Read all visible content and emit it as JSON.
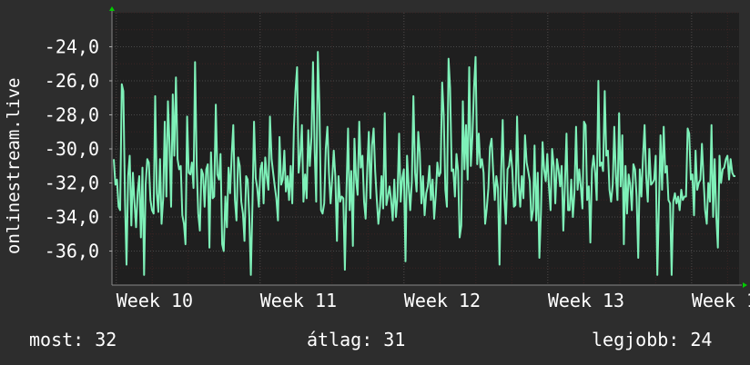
{
  "colors": {
    "background": "#2d2d2d",
    "plot_background": "#1f1f1f",
    "line": "#7ef0b8",
    "grid_major": "#4a4a4a",
    "grid_minor": "#3a2323",
    "text": "#ffffff",
    "axis_arrow": "#00cc00"
  },
  "chart_data": {
    "type": "line",
    "ylabel": "onlinestream.live",
    "ylim": [
      -38.0,
      -22.0
    ],
    "yticks": [
      "-24,0",
      "-26,0",
      "-28,0",
      "-30,0",
      "-32,0",
      "-34,0",
      "-36,0"
    ],
    "yticks_values": [
      -24,
      -26,
      -28,
      -30,
      -32,
      -34,
      -36
    ],
    "xticks": [
      "Week 10",
      "Week 11",
      "Week 12",
      "Week 13",
      "Week 1"
    ],
    "xticks_pos": [
      10,
      11,
      12,
      13,
      14
    ],
    "xlim": [
      9.97,
      14.33
    ],
    "grid": true,
    "series": [
      {
        "values": [
          -30.6,
          -32.1,
          -31.8,
          -33.4,
          -33.6,
          -26.2,
          -26.6,
          -32.9,
          -36.8,
          -31.6,
          -30.4,
          -34.5,
          -31.4,
          -33.2,
          -34.6,
          -32.5,
          -31.6,
          -35.2,
          -31.1,
          -37.4,
          -32.1,
          -30.6,
          -30.8,
          -33.0,
          -33.6,
          -33.8,
          -26.9,
          -32.6,
          -33.7,
          -30.6,
          -34.4,
          -32.9,
          -28.4,
          -32.8,
          -27.2,
          -29.8,
          -33.4,
          -26.8,
          -30.4,
          -25.8,
          -30.6,
          -31.2,
          -31.0,
          -33.9,
          -34.4,
          -35.6,
          -28.1,
          -31.4,
          -31.5,
          -30.8,
          -32.3,
          -24.9,
          -31.0,
          -33.8,
          -34.8,
          -31.2,
          -31.5,
          -33.4,
          -31.2,
          -30.9,
          -35.8,
          -30.2,
          -32.9,
          -32.8,
          -27.4,
          -31.5,
          -31.8,
          -30.3,
          -35.6,
          -36.0,
          -32.8,
          -34.6,
          -31.1,
          -32.6,
          -30.3,
          -28.6,
          -33.0,
          -34.2,
          -30.5,
          -31.0,
          -33.1,
          -33.8,
          -35.4,
          -31.6,
          -31.8,
          -34.0,
          -37.4,
          -33.2,
          -28.4,
          -31.7,
          -32.3,
          -33.4,
          -31.2,
          -30.8,
          -33.2,
          -30.5,
          -31.6,
          -32.4,
          -28.1,
          -30.6,
          -31.4,
          -32.2,
          -32.9,
          -34.2,
          -29.3,
          -32.1,
          -31.8,
          -30.1,
          -32.5,
          -31.6,
          -33.0,
          -31.0,
          -33.2,
          -28.8,
          -26.6,
          -25.2,
          -31.4,
          -30.4,
          -28.6,
          -33.1,
          -31.5,
          -32.9,
          -28.9,
          -31.0,
          -29.3,
          -24.9,
          -30.1,
          -33.1,
          -24.3,
          -27.4,
          -33.6,
          -33.8,
          -33.2,
          -30.0,
          -28.7,
          -31.4,
          -33.2,
          -31.8,
          -30.1,
          -31.6,
          -35.4,
          -31.6,
          -33.1,
          -32.8,
          -32.9,
          -37.1,
          -32.4,
          -28.8,
          -33.6,
          -31.3,
          -35.7,
          -29.4,
          -31.8,
          -32.7,
          -28.4,
          -31.1,
          -30.4,
          -33.1,
          -34.1,
          -31.2,
          -29.0,
          -32.9,
          -29.8,
          -28.8,
          -31.3,
          -33.0,
          -34.4,
          -33.4,
          -31.6,
          -33.5,
          -27.9,
          -33.3,
          -32.8,
          -32.2,
          -33.0,
          -34.2,
          -31.8,
          -34.0,
          -32.8,
          -29.1,
          -33.1,
          -31.7,
          -31.2,
          -36.6,
          -30.4,
          -32.2,
          -33.6,
          -31.9,
          -26.9,
          -31.4,
          -32.5,
          -29.0,
          -30.2,
          -33.2,
          -31.6,
          -33.9,
          -32.6,
          -32.2,
          -31.0,
          -33.0,
          -31.8,
          -34.1,
          -32.7,
          -30.8,
          -31.6,
          -31.4,
          -26.1,
          -28.0,
          -32.4,
          -33.4,
          -24.7,
          -26.4,
          -31.3,
          -31.2,
          -32.8,
          -30.3,
          -31.3,
          -35.2,
          -34.5,
          -27.2,
          -31.2,
          -28.6,
          -31.8,
          -25.2,
          -31.0,
          -29.3,
          -26.4,
          -24.6,
          -30.9,
          -29.1,
          -31.1,
          -30.6,
          -31.4,
          -34.4,
          -33.5,
          -32.3,
          -29.9,
          -29.4,
          -31.3,
          -33.0,
          -31.6,
          -32.3,
          -36.8,
          -31.3,
          -28.3,
          -32.8,
          -34.4,
          -31.2,
          -31.0,
          -30.1,
          -31.2,
          -33.4,
          -33.3,
          -28.1,
          -32.0,
          -33.4,
          -31.6,
          -32.9,
          -29.2,
          -30.8,
          -31.3,
          -31.9,
          -34.2,
          -33.6,
          -29.8,
          -34.2,
          -31.4,
          -36.4,
          -33.8,
          -29.6,
          -31.2,
          -31.9,
          -30.3,
          -32.2,
          -33.6,
          -30.0,
          -31.0,
          -33.2,
          -30.6,
          -31.2,
          -32.2,
          -31.0,
          -34.8,
          -32.2,
          -29.1,
          -33.6,
          -33.6,
          -31.8,
          -34.0,
          -32.6,
          -28.7,
          -32.4,
          -31.2,
          -32.2,
          -33.5,
          -28.4,
          -28.6,
          -33.0,
          -32.2,
          -35.5,
          -31.2,
          -30.4,
          -31.4,
          -33.0,
          -26.0,
          -31.0,
          -30.8,
          -31.3,
          -26.6,
          -30.4,
          -30.1,
          -32.4,
          -33.1,
          -32.1,
          -28.7,
          -31.6,
          -33.0,
          -27.9,
          -32.2,
          -29.2,
          -35.6,
          -31.0,
          -33.8,
          -31.5,
          -32.1,
          -33.6,
          -30.9,
          -31.2,
          -32.8,
          -36.4,
          -31.2,
          -32.8,
          -30.5,
          -28.6,
          -31.6,
          -33.1,
          -30.0,
          -32.1,
          -32.0,
          -31.8,
          -30.4,
          -37.4,
          -33.4,
          -29.2,
          -32.4,
          -28.7,
          -31.4,
          -31.0,
          -33.0,
          -33.2,
          -37.4,
          -33.1,
          -32.6,
          -33.2,
          -32.8,
          -33.6,
          -32.4,
          -33.0,
          -32.8,
          -32.8,
          -28.8,
          -29.1,
          -31.8,
          -31.5,
          -33.9,
          -30.1,
          -32.4,
          -32.0,
          -31.8,
          -29.7,
          -31.8,
          -33.6,
          -34.4,
          -32.0,
          -33.1,
          -28.6,
          -34.0,
          -30.6,
          -34.0,
          -35.8,
          -30.4,
          -32.0,
          -31.2,
          -31.1,
          -30.6,
          -30.4,
          -31.8,
          -30.6,
          -31.4,
          -31.6,
          -31.6
        ]
      }
    ]
  },
  "footer": {
    "now": "most: 32",
    "avg": "átlag: 31",
    "best": "legjobb: 24"
  }
}
